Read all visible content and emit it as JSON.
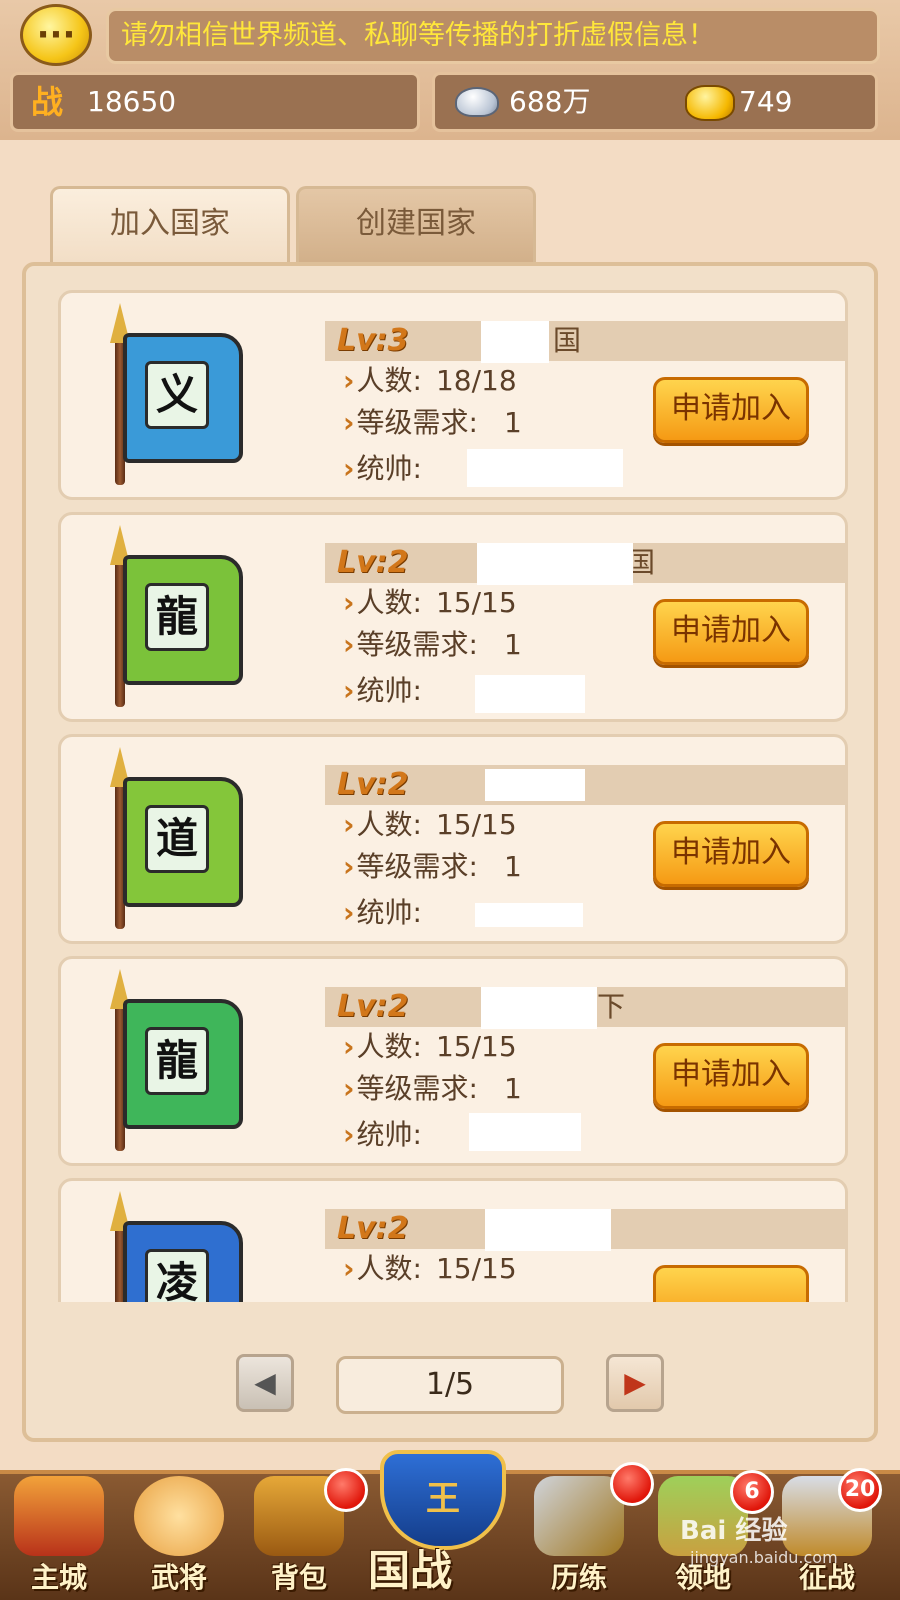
{
  "notice": "请勿相信世界频道、私聊等传播的打折虚假信息！",
  "stats": {
    "power_icon": "战",
    "power": "18650",
    "silver": "688万",
    "gold": "749"
  },
  "tabs": [
    {
      "label": "加入国家",
      "active": true
    },
    {
      "label": "创建国家",
      "active": false
    }
  ],
  "labels": {
    "members": "人数:",
    "level_req": "等级需求:",
    "leader": "统帅:",
    "apply": "申请加入"
  },
  "countries": [
    {
      "level": "Lv:3",
      "flag_char": "义",
      "flag_color": "#3a9ad8",
      "name_suffix": "国",
      "members": "18/18",
      "level_req": "1"
    },
    {
      "level": "Lv:2",
      "flag_char": "龍",
      "flag_color": "#7bc23a",
      "name_suffix": "国",
      "members": "15/15",
      "level_req": "1"
    },
    {
      "level": "Lv:2",
      "flag_char": "道",
      "flag_color": "#84c63a",
      "name_suffix": "",
      "members": "15/15",
      "level_req": "1"
    },
    {
      "level": "Lv:2",
      "flag_char": "龍",
      "flag_color": "#3fb65a",
      "name_suffix": "下",
      "members": "15/15",
      "level_req": "1"
    },
    {
      "level": "Lv:2",
      "flag_char": "凌",
      "flag_color": "#2f6fd0",
      "name_suffix": "",
      "members": "15/15",
      "level_req": ""
    }
  ],
  "pager": {
    "current": "1/5",
    "prev_icon": "◀",
    "next_icon": "▶"
  },
  "nav": {
    "items": [
      {
        "label": "主城",
        "icon": "palace-icon"
      },
      {
        "label": "武将",
        "icon": "generals-icon"
      },
      {
        "label": "背包",
        "icon": "bag-icon",
        "badge": ""
      },
      {
        "label": "国战",
        "icon": "king-shield-icon",
        "emblem": "王"
      },
      {
        "label": "历练",
        "icon": "swords-icon",
        "badge": ""
      },
      {
        "label": "领地",
        "icon": "territory-icon",
        "badge": "6"
      },
      {
        "label": "征战",
        "icon": "battle-icon",
        "badge": "20"
      }
    ]
  },
  "watermark": {
    "main": "Bai 经验",
    "sub": "jingyan.baidu.com"
  }
}
